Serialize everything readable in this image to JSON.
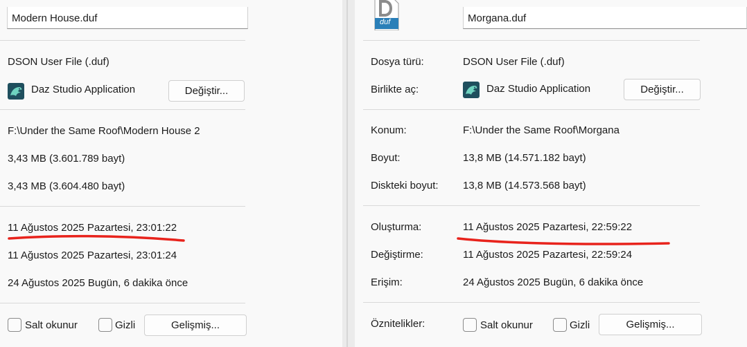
{
  "left": {
    "file_name": "Modern House.duf",
    "file_type": "DSON User File (.duf)",
    "open_with_app": "Daz Studio Application",
    "change_button": "Değiştir...",
    "location": "F:\\Under the Same Roof\\Modern House 2",
    "size": "3,43 MB (3.601.789 bayt)",
    "size_on_disk": "3,43 MB (3.604.480 bayt)",
    "created": "11 Ağustos 2025 Pazartesi, 23:01:22",
    "modified": "11 Ağustos 2025 Pazartesi, 23:01:24",
    "accessed": "24 Ağustos 2025 Bugün, 6 dakika önce",
    "readonly_label": "Salt okunur",
    "hidden_label": "Gizli",
    "advanced_button": "Gelişmiş..."
  },
  "right": {
    "file_icon_label": "duf",
    "file_name": "Morgana.duf",
    "labels": {
      "file_type": "Dosya türü:",
      "open_with": "Birlikte aç:",
      "location": "Konum:",
      "size": "Boyut:",
      "size_on_disk": "Diskteki boyut:",
      "created": "Oluşturma:",
      "modified": "Değiştirme:",
      "accessed": "Erişim:",
      "attributes": "Öznitelikler:"
    },
    "file_type": "DSON User File (.duf)",
    "open_with_app": "Daz Studio Application",
    "change_button": "Değiştir...",
    "location": "F:\\Under the Same Roof\\Morgana",
    "size": "13,8 MB (14.571.182 bayt)",
    "size_on_disk": "13,8 MB (14.573.568 bayt)",
    "created": "11 Ağustos 2025 Pazartesi, 22:59:22",
    "modified": "11 Ağustos 2025 Pazartesi, 22:59:24",
    "accessed": "24 Ağustos 2025 Bugün, 6 dakika önce",
    "readonly_label": "Salt okunur",
    "hidden_label": "Gizli",
    "advanced_button": "Gelişmiş..."
  },
  "colors": {
    "annotation_underline": "#e8231c",
    "app_icon_bg": "#1f4f5e",
    "file_icon_band": "#2a7fb8"
  }
}
